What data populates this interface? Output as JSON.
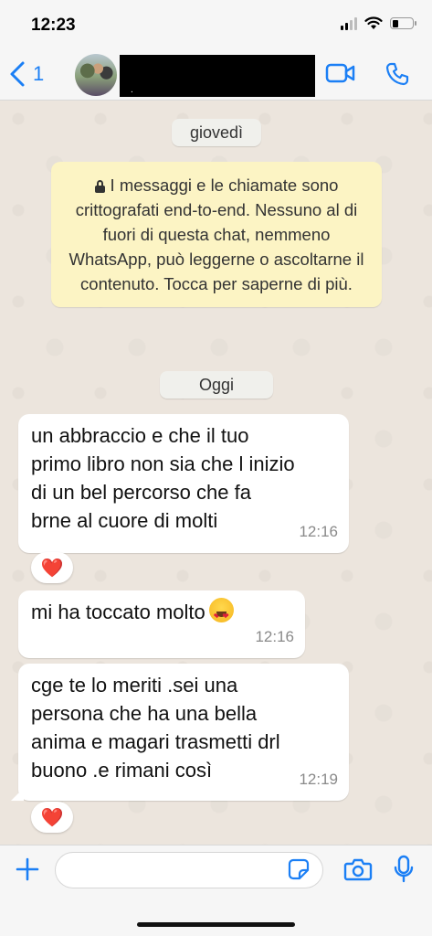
{
  "status_bar": {
    "time": "12:23"
  },
  "header": {
    "back_count": "1",
    "contact_subtitle": ".",
    "icons": {
      "back": "chevron-left-icon",
      "video": "video-camera-icon",
      "call": "phone-icon"
    }
  },
  "chat": {
    "date_chips": [
      "giovedì",
      "Oggi"
    ],
    "system_message": "I messaggi e le chiamate sono crittografati end-to-end. Nessuno al di fuori di questa chat, nemmeno WhatsApp, può leggerne o ascoltarne il contenuto. Tocca per saperne di più.",
    "messages": [
      {
        "text": "un abbraccio e che il tuo\nprimo libro non sia che l inizio\ndi un bel percorso che fa\nbrne al cuore di molti",
        "time": "12:16",
        "reaction": "❤️"
      },
      {
        "text": "mi ha toccato molto",
        "emoji": "😍",
        "time": "12:16"
      },
      {
        "text": "cge te lo meriti  .sei una\npersona che ha una bella\nanima e magari trasmetti drl\nbuono .e rimani così",
        "time": "12:19",
        "reaction": "❤️"
      }
    ]
  },
  "input_bar": {
    "placeholder": "",
    "icons": {
      "add": "plus-icon",
      "sticker": "sticker-icon",
      "camera": "camera-icon",
      "mic": "microphone-icon"
    }
  },
  "colors": {
    "accent": "#1b7ff5",
    "chat_bg": "#ece5dd",
    "system_bg": "#fcf4c4",
    "bubble": "#ffffff"
  }
}
